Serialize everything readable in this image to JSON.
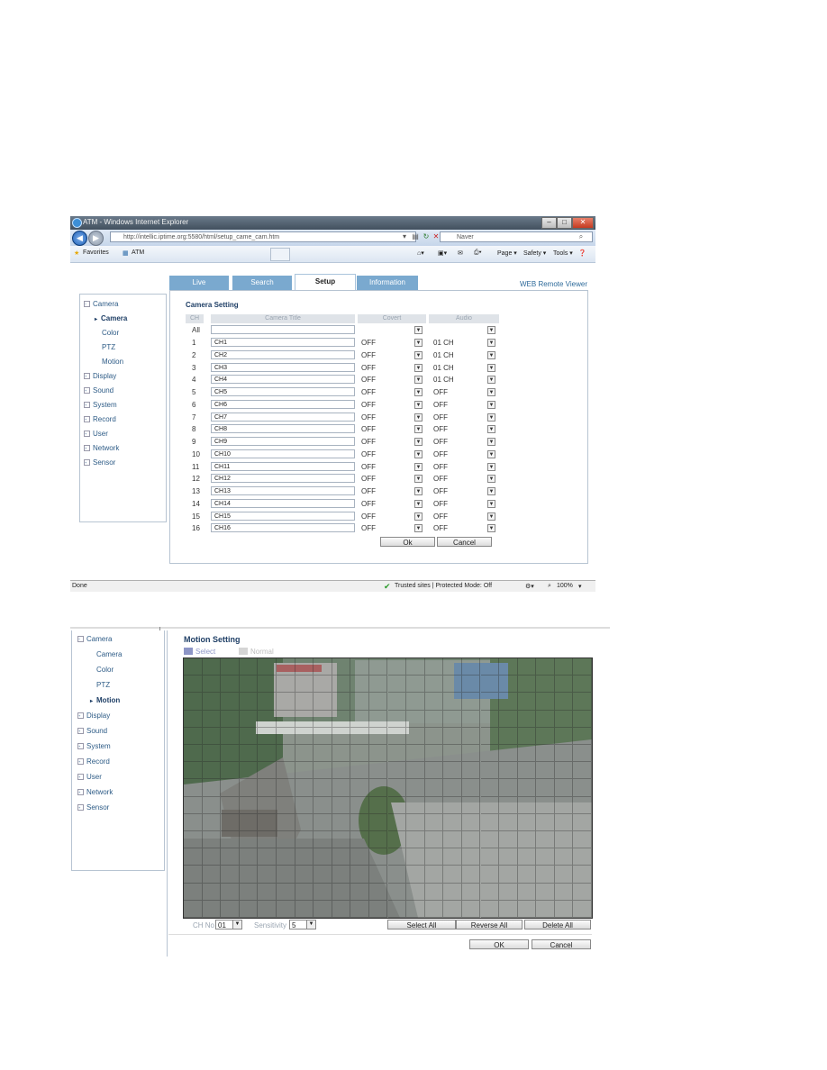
{
  "window": {
    "title": "ATM - Windows Internet Explorer",
    "address": "http://intellic.iptime.org:5580/html/setup_came_cam.htm",
    "search_provider": "Naver",
    "favorites_label": "Favorites",
    "tab_label": "ATM",
    "cmd": {
      "page": "Page ▾",
      "safety": "Safety ▾",
      "tools": "Tools ▾"
    },
    "status_left": "Done",
    "status_zone": "Trusted sites | Protected Mode: Off",
    "zoom": "100%"
  },
  "tabs": [
    "Live",
    "Search",
    "Setup",
    "Information"
  ],
  "active_tab": "Setup",
  "brand": "WEB Remote Viewer",
  "menu": {
    "camera": "Camera",
    "camera_sub": [
      "Camera",
      "Color",
      "PTZ",
      "Motion"
    ],
    "rest": [
      "Display",
      "Sound",
      "System",
      "Record",
      "User",
      "Network",
      "Sensor"
    ]
  },
  "camera_setting": {
    "title": "Camera Setting",
    "headers": {
      "ch": "CH",
      "title": "Camera Title",
      "covert": "Covert",
      "audio": "Audio"
    },
    "all_label": "All",
    "rows": [
      {
        "ch": "1",
        "title": "CH1",
        "covert": "OFF",
        "audio": "01  CH"
      },
      {
        "ch": "2",
        "title": "CH2",
        "covert": "OFF",
        "audio": "01  CH"
      },
      {
        "ch": "3",
        "title": "CH3",
        "covert": "OFF",
        "audio": "01  CH"
      },
      {
        "ch": "4",
        "title": "CH4",
        "covert": "OFF",
        "audio": "01  CH"
      },
      {
        "ch": "5",
        "title": "CH5",
        "covert": "OFF",
        "audio": "OFF"
      },
      {
        "ch": "6",
        "title": "CH6",
        "covert": "OFF",
        "audio": "OFF"
      },
      {
        "ch": "7",
        "title": "CH7",
        "covert": "OFF",
        "audio": "OFF"
      },
      {
        "ch": "8",
        "title": "CH8",
        "covert": "OFF",
        "audio": "OFF"
      },
      {
        "ch": "9",
        "title": "CH9",
        "covert": "OFF",
        "audio": "OFF"
      },
      {
        "ch": "10",
        "title": "CH10",
        "covert": "OFF",
        "audio": "OFF"
      },
      {
        "ch": "11",
        "title": "CH11",
        "covert": "OFF",
        "audio": "OFF"
      },
      {
        "ch": "12",
        "title": "CH12",
        "covert": "OFF",
        "audio": "OFF"
      },
      {
        "ch": "13",
        "title": "CH13",
        "covert": "OFF",
        "audio": "OFF"
      },
      {
        "ch": "14",
        "title": "CH14",
        "covert": "OFF",
        "audio": "OFF"
      },
      {
        "ch": "15",
        "title": "CH15",
        "covert": "OFF",
        "audio": "OFF"
      },
      {
        "ch": "16",
        "title": "CH16",
        "covert": "OFF",
        "audio": "OFF"
      }
    ],
    "ok": "Ok",
    "cancel": "Cancel"
  },
  "motion_setting": {
    "title": "Motion Setting",
    "legend_select": "Select",
    "legend_normal": "Normal",
    "ch_label": "CH No",
    "ch_value": "01",
    "sensitivity_label": "Sensitivity",
    "sensitivity_value": "5",
    "select_all": "Select All",
    "reverse_all": "Reverse All",
    "delete_all": "Delete All",
    "ok": "OK",
    "cancel": "Cancel"
  },
  "colors": {
    "tab": "#7aa9cf",
    "menu_text": "#2d5b86",
    "select_swatch": "#8d95c6",
    "normal_swatch": "#d5d5d5"
  }
}
